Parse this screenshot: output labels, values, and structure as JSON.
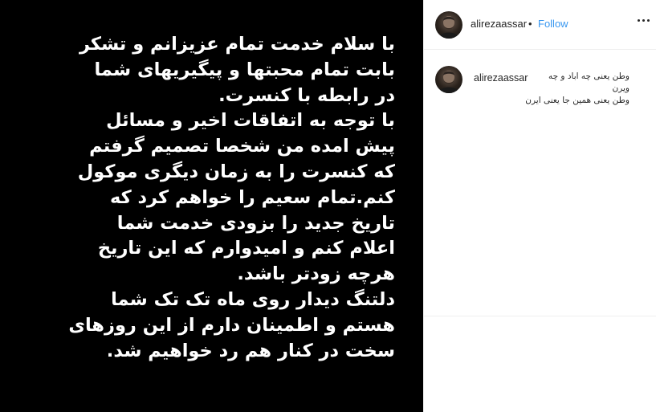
{
  "post": {
    "image_text_lines": [
      "با سلام خدمت تمام عزیزانم و تشکر",
      "بابت تمام محبتها و پیگیریهای شما",
      "در رابطه با کنسرت.",
      "با توجه به اتفاقات اخیر و مسائل",
      "پیش امده من شخصا تصمیم گرفتم",
      "که کنسرت را به زمان دیگری موکول",
      "کنم.تمام سعیم را خواهم کرد که",
      "تاریخ جدید را بزودی خدمت شما",
      "اعلام کنم و امیدوارم که این تاریخ",
      "هرچه زودتر باشد.",
      "دلتنگ دیدار روی ماه تک تک شما",
      "هستم و اطمینان دارم از این روزهای",
      "سخت در کنار هم رد خواهیم شد."
    ]
  },
  "header": {
    "username": "alirezaassar",
    "separator": "•",
    "follow_label": "Follow",
    "more_icon": "more-horizontal-icon"
  },
  "caption": {
    "username": "alirezaassar",
    "lines": [
      "وطن یعنی چه اباد و چه",
      "ویرن",
      "وطن یعنی همین جا یعنی ایرن"
    ]
  },
  "colors": {
    "post_background": "#000000",
    "post_text": "#ffffff",
    "link": "#3897f0",
    "text": "#262626",
    "border": "#efefef"
  }
}
